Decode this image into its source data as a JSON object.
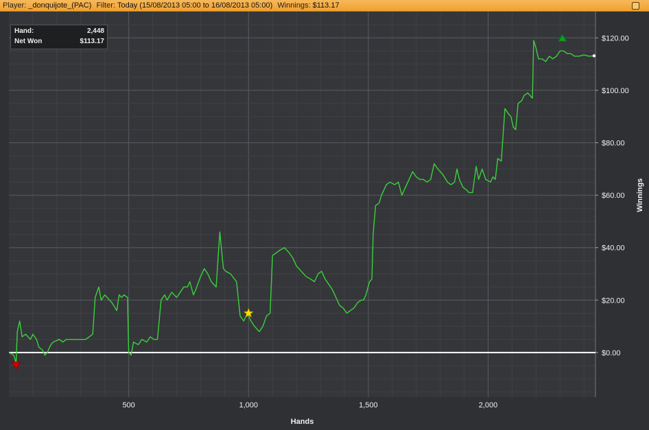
{
  "titlebar": {
    "player_label": "Player:",
    "player_value": "_donquijote_(PAC)",
    "filter_label": "Filter:",
    "filter_value": "Today (15/08/2013 05:00 to 16/08/2013 05:00)",
    "winnings_label": "Winnings:",
    "winnings_value": "$113.17"
  },
  "infobox": {
    "hand_label": "Hand:",
    "hand_value": "2,448",
    "netwon_label": "Net Won",
    "netwon_value": "$113.17"
  },
  "colors": {
    "line": "#3bd23b",
    "zero_line": "#ffffff",
    "grid": "#4a4c50",
    "background": "#2f3033",
    "min_marker": "#d40000",
    "max_marker": "#12a012",
    "star": "#ffe000"
  },
  "chart_data": {
    "type": "line",
    "xlabel": "Hands",
    "ylabel": "Winnings",
    "xlim": [
      0,
      2448
    ],
    "ylim": [
      -17,
      130
    ],
    "xticks": [
      500,
      1000,
      1500,
      2000
    ],
    "xtick_labels": [
      "500",
      "1,000",
      "1,500",
      "2,000"
    ],
    "yticks": [
      0,
      20,
      40,
      60,
      80,
      100,
      120
    ],
    "ytick_labels": [
      "$0.00",
      "$20.00",
      "$40.00",
      "$60.00",
      "$80.00",
      "$100.00",
      "$120.00"
    ],
    "grid": true,
    "markers": [
      {
        "type": "min",
        "x": 30,
        "y": -5
      },
      {
        "type": "star",
        "x": 1000,
        "y": 15
      },
      {
        "type": "max",
        "x": 2310,
        "y": 120
      },
      {
        "type": "end",
        "x": 2448,
        "y": 113.17
      }
    ],
    "series": [
      {
        "points": [
          [
            0,
            0
          ],
          [
            20,
            -1
          ],
          [
            30,
            -4
          ],
          [
            35,
            8
          ],
          [
            45,
            12
          ],
          [
            55,
            6
          ],
          [
            70,
            7
          ],
          [
            90,
            5
          ],
          [
            100,
            7
          ],
          [
            115,
            5
          ],
          [
            125,
            2
          ],
          [
            140,
            1
          ],
          [
            150,
            -1
          ],
          [
            160,
            0
          ],
          [
            175,
            3
          ],
          [
            185,
            4
          ],
          [
            210,
            5
          ],
          [
            225,
            4
          ],
          [
            240,
            5
          ],
          [
            260,
            5
          ],
          [
            300,
            5
          ],
          [
            320,
            5
          ],
          [
            350,
            7
          ],
          [
            360,
            21
          ],
          [
            375,
            25
          ],
          [
            385,
            20
          ],
          [
            400,
            22
          ],
          [
            420,
            20
          ],
          [
            430,
            19
          ],
          [
            450,
            16
          ],
          [
            460,
            22
          ],
          [
            470,
            21
          ],
          [
            480,
            22
          ],
          [
            495,
            21
          ],
          [
            500,
            0
          ],
          [
            510,
            -1
          ],
          [
            520,
            4
          ],
          [
            540,
            3
          ],
          [
            555,
            5
          ],
          [
            575,
            4
          ],
          [
            590,
            6
          ],
          [
            605,
            5
          ],
          [
            620,
            5
          ],
          [
            635,
            20
          ],
          [
            650,
            22
          ],
          [
            660,
            20
          ],
          [
            680,
            23
          ],
          [
            700,
            21
          ],
          [
            715,
            23
          ],
          [
            730,
            25
          ],
          [
            745,
            25
          ],
          [
            755,
            27
          ],
          [
            770,
            22
          ],
          [
            780,
            24
          ],
          [
            800,
            29
          ],
          [
            815,
            32
          ],
          [
            830,
            30
          ],
          [
            845,
            27
          ],
          [
            865,
            25
          ],
          [
            880,
            46
          ],
          [
            895,
            32
          ],
          [
            905,
            31
          ],
          [
            925,
            30
          ],
          [
            950,
            27
          ],
          [
            965,
            14
          ],
          [
            980,
            12
          ],
          [
            995,
            15
          ],
          [
            1010,
            12
          ],
          [
            1025,
            10
          ],
          [
            1045,
            8
          ],
          [
            1060,
            10
          ],
          [
            1075,
            14
          ],
          [
            1090,
            15
          ],
          [
            1100,
            37
          ],
          [
            1115,
            38
          ],
          [
            1130,
            39
          ],
          [
            1150,
            40
          ],
          [
            1170,
            38
          ],
          [
            1185,
            36
          ],
          [
            1200,
            33
          ],
          [
            1220,
            31
          ],
          [
            1240,
            29
          ],
          [
            1260,
            28
          ],
          [
            1275,
            27
          ],
          [
            1290,
            30
          ],
          [
            1305,
            31
          ],
          [
            1320,
            28
          ],
          [
            1335,
            26
          ],
          [
            1350,
            24
          ],
          [
            1365,
            21
          ],
          [
            1380,
            18
          ],
          [
            1395,
            17
          ],
          [
            1410,
            15
          ],
          [
            1425,
            16
          ],
          [
            1440,
            17
          ],
          [
            1455,
            19
          ],
          [
            1470,
            20
          ],
          [
            1480,
            20
          ],
          [
            1490,
            22
          ],
          [
            1505,
            27
          ],
          [
            1515,
            28
          ],
          [
            1520,
            45
          ],
          [
            1530,
            56
          ],
          [
            1545,
            57
          ],
          [
            1555,
            60
          ],
          [
            1575,
            64
          ],
          [
            1590,
            65
          ],
          [
            1610,
            64
          ],
          [
            1625,
            65
          ],
          [
            1640,
            60
          ],
          [
            1655,
            63
          ],
          [
            1670,
            66
          ],
          [
            1685,
            69
          ],
          [
            1700,
            67
          ],
          [
            1715,
            66
          ],
          [
            1730,
            66
          ],
          [
            1745,
            65
          ],
          [
            1760,
            66
          ],
          [
            1775,
            72
          ],
          [
            1790,
            70
          ],
          [
            1800,
            69
          ],
          [
            1810,
            68
          ],
          [
            1830,
            65
          ],
          [
            1845,
            64
          ],
          [
            1860,
            65
          ],
          [
            1870,
            70
          ],
          [
            1880,
            66
          ],
          [
            1895,
            63
          ],
          [
            1910,
            62
          ],
          [
            1920,
            61
          ],
          [
            1935,
            61
          ],
          [
            1950,
            71
          ],
          [
            1960,
            66
          ],
          [
            1975,
            70
          ],
          [
            1990,
            66
          ],
          [
            2010,
            65
          ],
          [
            2020,
            67
          ],
          [
            2030,
            66
          ],
          [
            2040,
            74
          ],
          [
            2055,
            73
          ],
          [
            2070,
            93
          ],
          [
            2085,
            91
          ],
          [
            2095,
            90
          ],
          [
            2105,
            86
          ],
          [
            2115,
            85
          ],
          [
            2125,
            95
          ],
          [
            2140,
            96
          ],
          [
            2150,
            98
          ],
          [
            2165,
            99
          ],
          [
            2175,
            98
          ],
          [
            2185,
            97
          ],
          [
            2190,
            119
          ],
          [
            2200,
            116
          ],
          [
            2210,
            112
          ],
          [
            2225,
            112
          ],
          [
            2240,
            111
          ],
          [
            2255,
            113
          ],
          [
            2270,
            112
          ],
          [
            2285,
            113
          ],
          [
            2300,
            115
          ],
          [
            2315,
            115
          ],
          [
            2330,
            114
          ],
          [
            2345,
            114
          ],
          [
            2360,
            113
          ],
          [
            2380,
            113
          ],
          [
            2400,
            113.5
          ],
          [
            2420,
            113
          ],
          [
            2448,
            113.17
          ]
        ]
      }
    ]
  }
}
